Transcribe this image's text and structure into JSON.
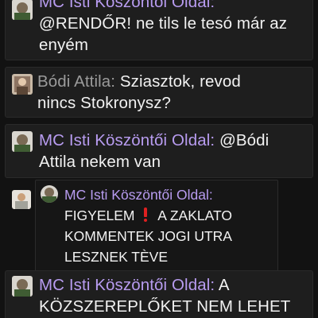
{
  "messages": [
    {
      "author": "MC Isti Köszöntői Oldal:",
      "line1_rest": "",
      "line2": "@RENDŐR! ne tils le tesó már az",
      "line3": "enyém"
    },
    {
      "author": "Bódi Attila:",
      "line1_rest": " Sziasztok, revod",
      "line2": "nincs Stokronysz?"
    },
    {
      "author": "MC Isti Köszöntői Oldal:",
      "line1_rest": " @Bódi",
      "line2": "Attila nekem van"
    },
    {
      "quote": {
        "author": "MC Isti Köszöntői Oldal:",
        "line1_a": "FIGYELEM",
        "warning_icon": "heavy-exclamation-mark-icon",
        "line1_b": "A ZAKLATO",
        "line2": "KOMMENTEK JOGI UTRA",
        "line3": "LESZNEK TÈVE"
      }
    },
    {
      "author": "MC Isti Köszöntői Oldal:",
      "line1_rest": " A",
      "line2": "KÖZSZEREPLŐKET NEM LEHET"
    }
  ],
  "colors": {
    "background": "#121212",
    "card": "#1e1e1e",
    "mc_author": "#b89cf0",
    "bodi_author": "#9b9b9b",
    "warning": "#e02020"
  }
}
